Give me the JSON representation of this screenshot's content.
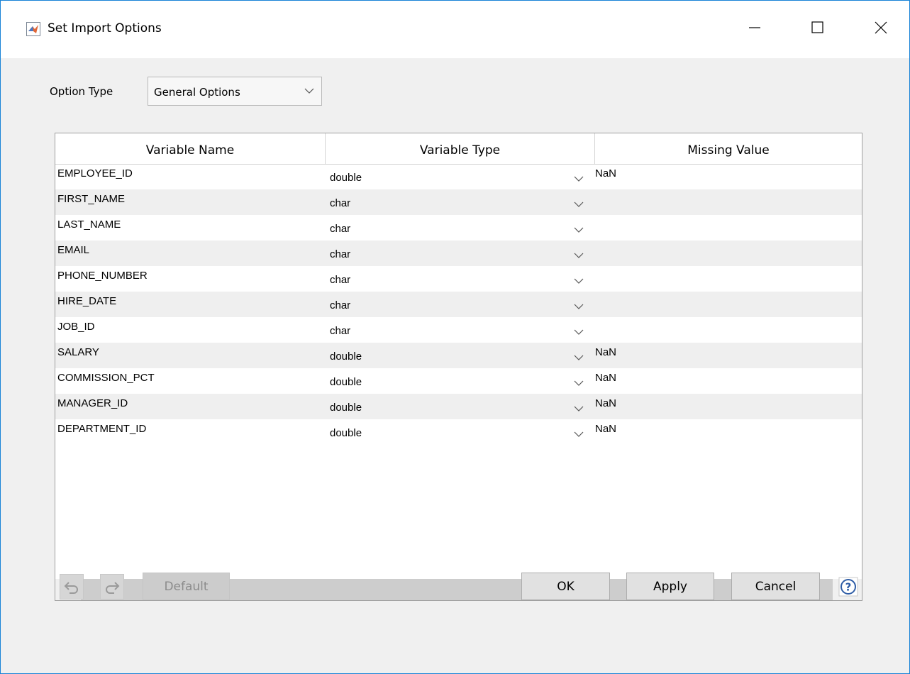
{
  "window": {
    "title": "Set Import Options"
  },
  "option_type": {
    "label": "Option Type",
    "value": "General Options"
  },
  "table": {
    "headers": [
      "Variable Name",
      "Variable Type",
      "Missing Value"
    ],
    "rows": [
      {
        "name": "EMPLOYEE_ID",
        "type": "double",
        "missing": "NaN"
      },
      {
        "name": "FIRST_NAME",
        "type": "char",
        "missing": ""
      },
      {
        "name": "LAST_NAME",
        "type": "char",
        "missing": ""
      },
      {
        "name": "EMAIL",
        "type": "char",
        "missing": ""
      },
      {
        "name": "PHONE_NUMBER",
        "type": "char",
        "missing": ""
      },
      {
        "name": "HIRE_DATE",
        "type": "char",
        "missing": ""
      },
      {
        "name": "JOB_ID",
        "type": "char",
        "missing": ""
      },
      {
        "name": "SALARY",
        "type": "double",
        "missing": "NaN"
      },
      {
        "name": "COMMISSION_PCT",
        "type": "double",
        "missing": "NaN"
      },
      {
        "name": "MANAGER_ID",
        "type": "double",
        "missing": "NaN"
      },
      {
        "name": "DEPARTMENT_ID",
        "type": "double",
        "missing": "NaN"
      }
    ]
  },
  "buttons": {
    "default_label": "Default",
    "ok_label": "OK",
    "apply_label": "Apply",
    "cancel_label": "Cancel"
  },
  "icons": {
    "app": "matlab-icon",
    "minimize": "minimize-icon",
    "maximize": "maximize-icon",
    "close": "close-icon",
    "undo": "undo-icon",
    "redo": "redo-icon",
    "help": "help-icon"
  },
  "colors": {
    "window_border": "#1883d7",
    "alt_row": "#efefef",
    "dialog_bg": "#f0f0f0"
  }
}
